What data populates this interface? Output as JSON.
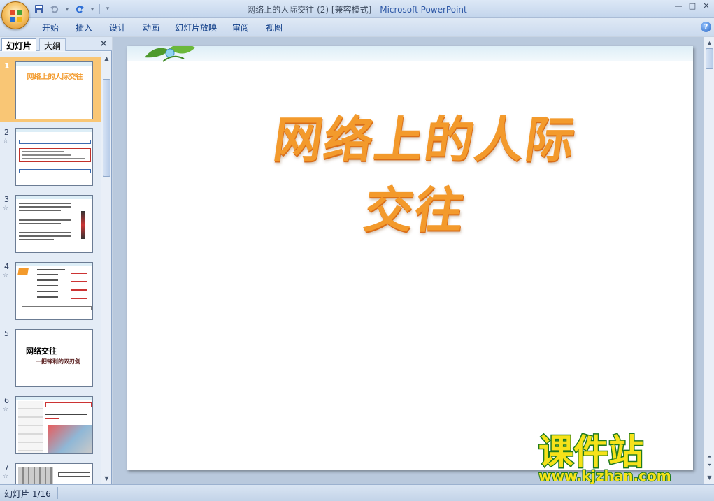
{
  "window": {
    "title": "网络上的人际交往 (2) [兼容模式] - ",
    "app_name": "Microsoft PowerPoint",
    "controls": [
      "—",
      "□",
      "✕"
    ]
  },
  "ribbon": {
    "tabs": [
      "开始",
      "插入",
      "设计",
      "动画",
      "幻灯片放映",
      "审阅",
      "视图"
    ],
    "help_label": "?"
  },
  "left_pane": {
    "tabs": [
      "幻灯片",
      "大纲"
    ],
    "close_label": "✕",
    "slides": [
      {
        "num": "1",
        "title": "网络上的人际交往"
      },
      {
        "num": "2",
        "title": ""
      },
      {
        "num": "3",
        "title": ""
      },
      {
        "num": "4",
        "title": ""
      },
      {
        "num": "5",
        "title": "网络交往",
        "subtitle": "一把锋利的双刃剑"
      },
      {
        "num": "6",
        "title": ""
      },
      {
        "num": "7",
        "title": ""
      }
    ],
    "star_glyph": "☆"
  },
  "slide": {
    "title": "网络上的人际交往"
  },
  "status_bar": {
    "slide_counter": "幻灯片 1/16"
  },
  "watermark": {
    "line1": "课件站",
    "line2": "www.kjzhan.com"
  },
  "colors": {
    "accent": "#15428b",
    "title_orange": "#f39a2c",
    "selected_slide": "#f9c675"
  }
}
